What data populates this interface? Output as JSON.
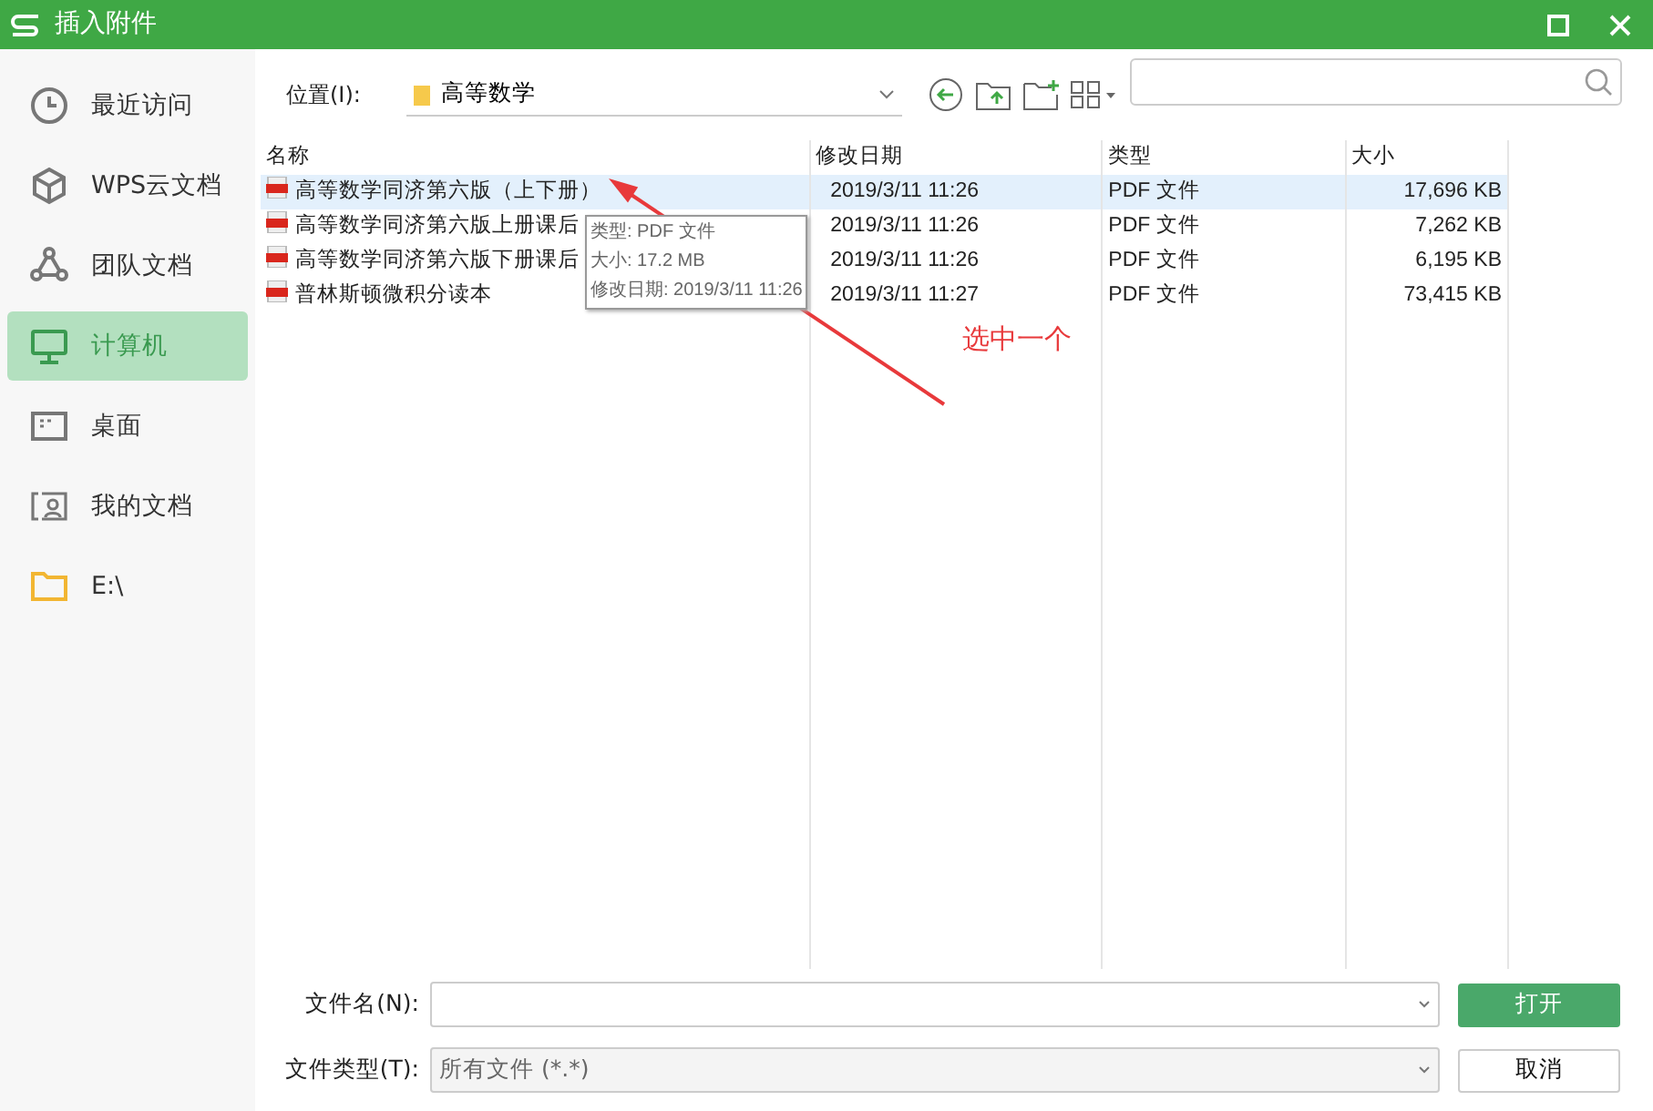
{
  "window": {
    "title": "插入附件"
  },
  "sidebar": {
    "items": [
      {
        "label": "最近访问",
        "selected": false
      },
      {
        "label": "WPS云文档",
        "selected": false
      },
      {
        "label": "团队文档",
        "selected": false
      },
      {
        "label": "计算机",
        "selected": true
      },
      {
        "label": "桌面",
        "selected": false
      },
      {
        "label": "我的文档",
        "selected": false
      },
      {
        "label": "E:\\",
        "selected": false
      }
    ]
  },
  "location": {
    "label": "位置(I):",
    "value": "高等数学"
  },
  "table": {
    "columns": [
      "名称",
      "修改日期",
      "类型",
      "大小"
    ],
    "rows": [
      {
        "name": "高等数学同济第六版（上下册）",
        "date": "2019/3/11 11:26",
        "type": "PDF 文件",
        "size": "17,696 KB",
        "selected": true
      },
      {
        "name": "高等数学同济第六版上册课后",
        "date": "2019/3/11 11:26",
        "type": "PDF 文件",
        "size": "7,262 KB",
        "selected": false
      },
      {
        "name": "高等数学同济第六版下册课后",
        "date": "2019/3/11 11:26",
        "type": "PDF 文件",
        "size": "6,195 KB",
        "selected": false
      },
      {
        "name": "普林斯顿微积分读本",
        "date": "2019/3/11 11:27",
        "type": "PDF 文件",
        "size": "73,415 KB",
        "selected": false
      }
    ]
  },
  "tooltip": [
    "类型: PDF 文件",
    "大小: 17.2 MB",
    "修改日期: 2019/3/11 11:26"
  ],
  "annotation": {
    "text": "选中一个"
  },
  "filename": {
    "label": "文件名(N):"
  },
  "filetype": {
    "label": "文件类型(T):",
    "value": "所有文件 (*.*)"
  },
  "buttons": [
    {
      "label": "打开",
      "kind": "primary"
    },
    {
      "label": "取消",
      "kind": "secondary"
    }
  ]
}
